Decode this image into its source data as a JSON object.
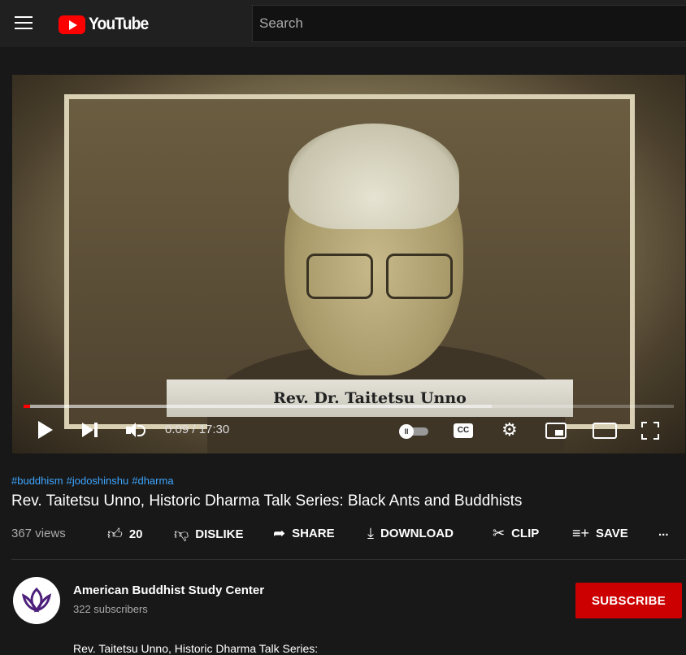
{
  "header": {
    "logo_text": "YouTube",
    "search_placeholder": "Search"
  },
  "player": {
    "caption": "Rev. Dr. Taitetsu Unno",
    "time_display": "0:09 / 17:30",
    "progress_fraction": 0.0087,
    "buffered_fraction": 0.72,
    "cc_label": "CC",
    "autoplay_label": "II"
  },
  "video": {
    "hashtags": [
      "#buddhism",
      "#jodoshinshu",
      "#dharma"
    ],
    "title": "Rev. Taitetsu Unno, Historic Dharma Talk Series: Black Ants and Buddhists",
    "views": "367 views"
  },
  "actions": {
    "like_count": "20",
    "dislike_label": "DISLIKE",
    "share_label": "SHARE",
    "download_label": "DOWNLOAD",
    "clip_label": "CLIP",
    "save_label": "SAVE",
    "more_label": "..."
  },
  "channel": {
    "name": "American Buddhist Study Center",
    "subscribers": "322 subscribers",
    "subscribe_label": "SUBSCRIBE"
  },
  "description": {
    "first_line": "Rev. Taitetsu Unno, Historic Dharma Talk Series:"
  },
  "colors": {
    "background": "#181818",
    "topbar": "#202020",
    "brand_red": "#ff0000",
    "subscribe_red": "#cc0000",
    "link_blue": "#3ea6ff"
  },
  "icons": [
    "menu-icon",
    "youtube-logo-icon",
    "play-icon",
    "next-icon",
    "volume-icon",
    "autoplay-toggle-icon",
    "cc-icon",
    "gear-icon",
    "miniplayer-icon",
    "theater-icon",
    "fullscreen-icon",
    "thumbs-up-icon",
    "thumbs-down-icon",
    "share-icon",
    "download-icon",
    "scissors-icon",
    "playlist-add-icon",
    "more-icon",
    "lotus-icon"
  ]
}
